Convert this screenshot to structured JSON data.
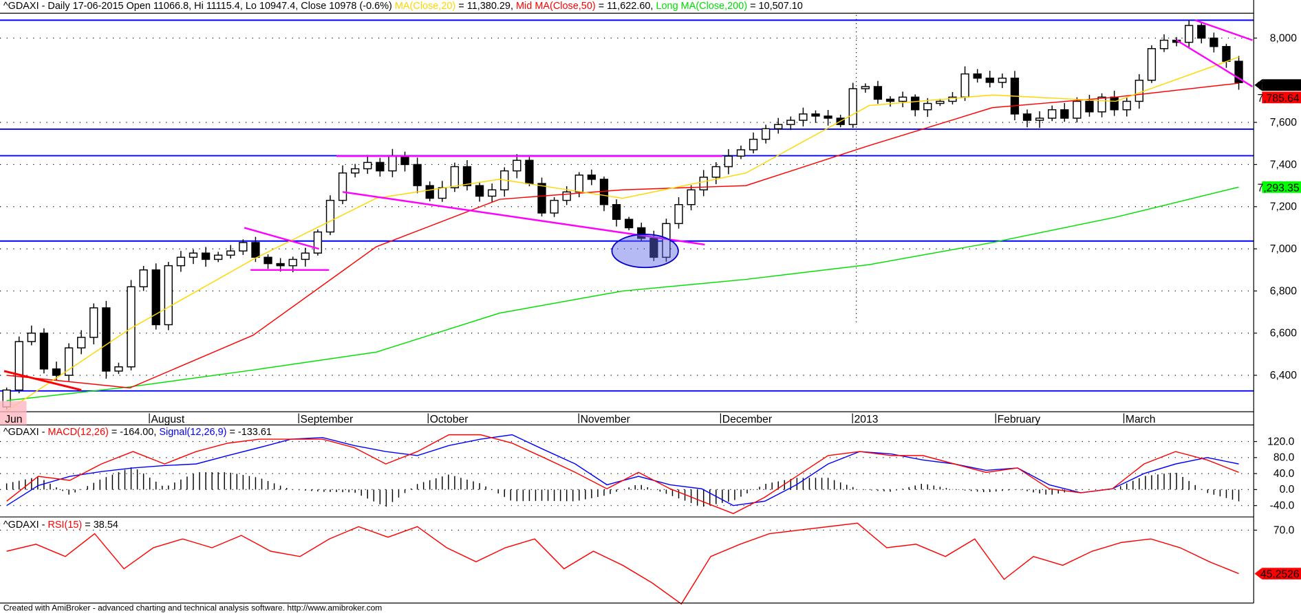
{
  "header": {
    "symbol_info": "^GDAXI - Daily 17-06-2015 Open 11066.8, Hi 11115.4, Lo 10947.4, Close 10978 (-0.6%) ",
    "ma20_label": "MA(Close,20)",
    "ma20_value": " = 11,380.29, ",
    "ma50_label": "Mid MA(Close,50)",
    "ma50_value": " = 11,622.60, ",
    "ma200_label": "Long MA(Close,200)",
    "ma200_value": " = 10,507.10"
  },
  "macd_header": {
    "symbol": "^GDAXI - ",
    "macd_label": "MACD(12,26)",
    "macd_value": " = -164.00, ",
    "signal_label": "Signal(12,26,9)",
    "signal_value": " = -133.61"
  },
  "rsi_header": {
    "symbol": "^GDAXI - ",
    "rsi_label": "RSI(15)",
    "rsi_value": " = 38.54"
  },
  "footer": "Created with AmiBroker - advanced charting and technical analysis software. http://www.amibroker.com",
  "colors": {
    "ma20": "#ffd700",
    "ma50": "#ff0000",
    "ma200": "#00e000",
    "support": "#0000ff",
    "trend": "#ff00ff",
    "macd": "#ff0000",
    "signal": "#0000ff",
    "rsi": "#ff0000"
  },
  "chart_data": [
    {
      "type": "candlestick",
      "title": "^GDAXI Daily",
      "ylim": [
        6250,
        8120
      ],
      "y_ticks": [
        "6,400",
        "6,600",
        "6,800",
        "7,000",
        "7,200",
        "7,400",
        "7,600",
        "8,000"
      ],
      "y_tick_values": [
        6400,
        6600,
        6800,
        7000,
        7200,
        7400,
        7600,
        8000
      ],
      "x_labels": [
        {
          "label": "Jun",
          "index": 0
        },
        {
          "label": "August",
          "index": 12
        },
        {
          "label": "September",
          "index": 24
        },
        {
          "label": "October",
          "index": 34.4
        },
        {
          "label": "November",
          "index": 46.5
        },
        {
          "label": "December",
          "index": 57.9
        },
        {
          "label": "2013",
          "index": 68.5
        },
        {
          "label": "February",
          "index": 80
        },
        {
          "label": "March",
          "index": 90.3
        }
      ],
      "first_open": 6250,
      "closes": [
        6330,
        6560,
        6600,
        6430,
        6400,
        6530,
        6580,
        6720,
        6420,
        6440,
        6820,
        6900,
        6640,
        6920,
        6960,
        6980,
        6950,
        6970,
        6990,
        7030,
        6960,
        6930,
        6920,
        6950,
        6980,
        7080,
        7230,
        7360,
        7380,
        7410,
        7370,
        7440,
        7400,
        7300,
        7240,
        7290,
        7390,
        7300,
        7250,
        7280,
        7370,
        7420,
        7310,
        7170,
        7230,
        7270,
        7350,
        7330,
        7210,
        7140,
        7100,
        7050,
        6960,
        7120,
        7210,
        7280,
        7340,
        7390,
        7440,
        7470,
        7520,
        7570,
        7590,
        7610,
        7640,
        7630,
        7620,
        7590,
        7760,
        7770,
        7710,
        7700,
        7720,
        7660,
        7690,
        7700,
        7720,
        7830,
        7810,
        7790,
        7810,
        7640,
        7610,
        7620,
        7660,
        7620,
        7700,
        7650,
        7720,
        7660,
        7700,
        7800,
        7950,
        7990,
        7980,
        8060,
        8000,
        7960,
        7890,
        7789
      ],
      "ma20": [
        6230,
        6620,
        6950,
        7240,
        7330,
        7240,
        7360,
        7680,
        7730,
        7700,
        7910
      ],
      "ma50": [
        6400,
        6340,
        6590,
        7010,
        7235,
        7280,
        7300,
        7490,
        7670,
        7720,
        7786
      ],
      "ma200": [
        6280,
        6345,
        6425,
        6510,
        6695,
        6800,
        6855,
        6925,
        7030,
        7150,
        7293
      ],
      "support_levels": [
        8085,
        7568,
        7442,
        7037,
        6326
      ],
      "trendlines": [
        {
          "color": "trend",
          "points": [
            [
              19.1,
              7100
            ],
            [
              25.1,
              7000
            ]
          ]
        },
        {
          "color": "trend",
          "points": [
            [
              19.6,
              6900
            ],
            [
              25.9,
              6900
            ]
          ]
        },
        {
          "color": "trend",
          "points": [
            [
              27,
              7270
            ],
            [
              56.1,
              7020
            ]
          ]
        },
        {
          "color": "trend",
          "points": [
            [
              26.5,
              7440
            ],
            [
              57.5,
              7440
            ]
          ]
        },
        {
          "color": "trend",
          "points": [
            [
              95.5,
              8085
            ],
            [
              100.1,
              7990
            ]
          ]
        },
        {
          "color": "trend",
          "points": [
            [
              94,
              7990
            ],
            [
              100.1,
              7770
            ]
          ]
        },
        {
          "color": "ma50",
          "points": [
            [
              -0.2,
              6420
            ],
            [
              6,
              6330
            ]
          ]
        }
      ],
      "highlight_ellipse": {
        "index": 51.3,
        "price": 6990
      },
      "last_labels": {
        "close": "7,789.09",
        "ma50": "7,785.64",
        "ma200": "7,293.35"
      }
    },
    {
      "type": "line",
      "title": "MACD(12,26) / Signal(12,26,9)",
      "ylim": [
        -60,
        140
      ],
      "y_ticks": [
        "120.0",
        "80.0",
        "40.0",
        "0.0",
        "-40.0"
      ],
      "y_tick_values": [
        120,
        80,
        40,
        0,
        -40
      ],
      "macd": [
        -29,
        33,
        23,
        64,
        95,
        64,
        95,
        116,
        126,
        126,
        126,
        105,
        64,
        95,
        137,
        137,
        116,
        80,
        43,
        2,
        43,
        2,
        -29,
        -60,
        -19,
        33,
        85,
        95,
        85,
        85,
        64,
        43,
        54,
        2,
        -8,
        2,
        64,
        95,
        74,
        43
      ],
      "signal": [
        -40,
        10,
        33,
        45,
        54,
        60,
        64,
        85,
        105,
        126,
        130,
        110,
        95,
        85,
        110,
        126,
        137,
        100,
        64,
        12,
        33,
        12,
        2,
        -40,
        -29,
        12,
        64,
        95,
        89,
        74,
        64,
        48,
        54,
        12,
        -8,
        2,
        40,
        64,
        80,
        64
      ]
    },
    {
      "type": "line",
      "title": "RSI(15)",
      "y_ticks": [
        "70.0"
      ],
      "y_tick_values": [
        70
      ],
      "rsi": [
        58,
        62,
        55,
        68,
        48,
        60,
        65,
        60,
        67,
        58,
        55,
        65,
        72,
        66,
        72,
        60,
        52,
        60,
        65,
        48,
        58,
        50,
        40,
        28,
        55,
        62,
        68,
        70,
        72,
        74,
        60,
        62,
        55,
        65,
        42,
        55,
        50,
        58,
        63,
        65,
        60,
        52,
        45.25
      ],
      "last_label": "45.2526"
    }
  ]
}
